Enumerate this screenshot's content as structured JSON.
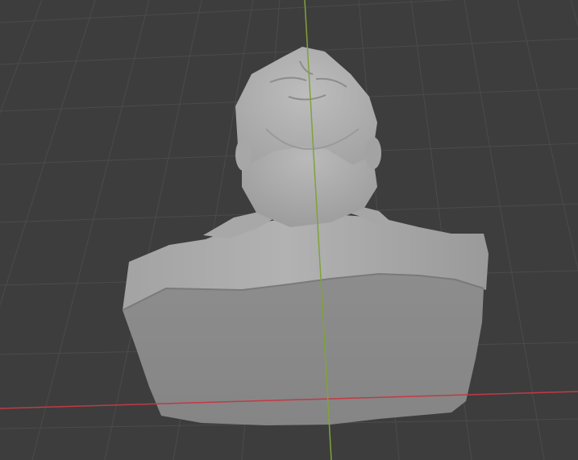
{
  "viewport": {
    "background_color": "#3d3d3d",
    "grid_color": "#4a4a4a",
    "x_axis_color": "#c13a45",
    "y_axis_color": "#7fa33a"
  },
  "object": {
    "type": "sculpt-mesh",
    "subject": "head-bust",
    "base_color": "#8f8f8f",
    "highlight_color": "#b4b4b4",
    "shadow_color": "#6f6f6f"
  }
}
